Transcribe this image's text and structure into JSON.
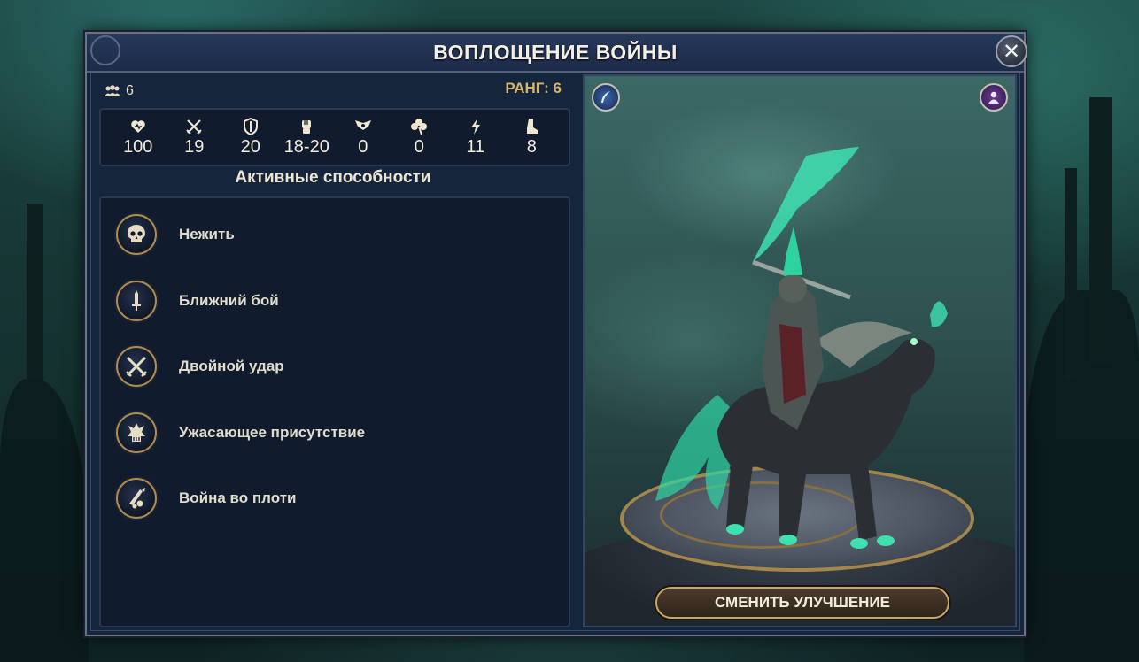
{
  "window": {
    "title": "ВОПЛОЩЕНИЕ ВОЙНЫ",
    "close_icon": "close-icon"
  },
  "unit": {
    "count": "6",
    "count_icon": "group-icon",
    "rank_label": "РАНГ: 6"
  },
  "stats": [
    {
      "icon": "heart-icon",
      "value": "100"
    },
    {
      "icon": "crossed-swords-icon",
      "value": "19"
    },
    {
      "icon": "shield-icon",
      "value": "20"
    },
    {
      "icon": "fist-icon",
      "value": "18-20"
    },
    {
      "icon": "winged-crest-icon",
      "value": "0"
    },
    {
      "icon": "clover-icon",
      "value": "0"
    },
    {
      "icon": "lightning-icon",
      "value": "11"
    },
    {
      "icon": "boot-icon",
      "value": "8"
    }
  ],
  "abilities": {
    "heading": "Активные способности",
    "items": [
      {
        "label": "Нежить",
        "icon": "skull-icon"
      },
      {
        "label": "Ближний бой",
        "icon": "sword-icon"
      },
      {
        "label": "Двойной удар",
        "icon": "double-strike-icon"
      },
      {
        "label": "Ужасающее присутствие",
        "icon": "terror-icon"
      },
      {
        "label": "Война во плоти",
        "icon": "war-incarnate-icon"
      }
    ]
  },
  "preview": {
    "change_button_label": "СМЕНИТЬ УЛУЧШЕНИЕ",
    "lore_icon": "quill-icon",
    "hero_icon": "hero-portrait-icon"
  },
  "colors": {
    "accent_gold": "#d8b465",
    "panel_bg": "#15253b",
    "spectral_green": "#3ee0b0"
  }
}
